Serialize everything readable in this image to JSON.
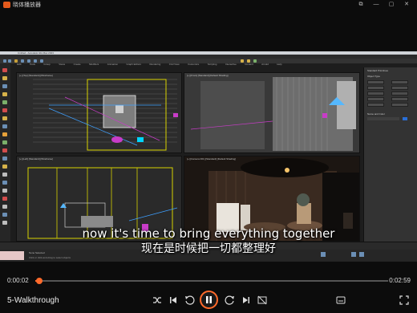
{
  "window": {
    "title": "晓体播放器",
    "controls": [
      "⧉",
      "—",
      "▢",
      "✕"
    ]
  },
  "video_frame": {
    "app_title": "Untitled - Autodesk 3ds Max 2023",
    "menu_items": [
      "File",
      "Edit",
      "Tools",
      "Group",
      "Views",
      "Create",
      "Modifiers",
      "Animation",
      "Graph Editors",
      "Rendering",
      "Civil View",
      "Customize",
      "Scripting",
      "Interactive",
      "Content",
      "Arnold",
      "Help"
    ],
    "viewports": [
      {
        "label": "[+] [Top] [Standard] [Wireframe]"
      },
      {
        "label": "[+] [Front] [Standard] [Default Shading]"
      },
      {
        "label": "[+] [Left] [Standard] [Wireframe]"
      },
      {
        "label": "[+] [Camera 001] [Standard] [Default Shading]"
      }
    ],
    "command_panel": {
      "title": "Standard Primitives",
      "section": "Object Type",
      "buttons": [
        "Box",
        "Cone",
        "Sphere",
        "GeoSphere",
        "Cylinder",
        "Tube",
        "Torus",
        "Pyramid",
        "Teapot",
        "Plane"
      ],
      "section2": "Name and Color"
    },
    "status": {
      "selection": "None Selected",
      "prompt": "Click or click-and-drag to select objects"
    }
  },
  "subtitles": {
    "english": "now it's time to bring everything together",
    "chinese": "现在是时候把一切都整理好"
  },
  "player": {
    "current_time": "0:00:02",
    "total_time": "0:02:59",
    "progress": 0.011,
    "video_name": "5-Walkthrough",
    "accent_color": "#ff6a2b"
  },
  "icons": {
    "shuffle": "shuffle-icon",
    "prev": "skip-previous-icon",
    "back": "rewind-10-icon",
    "play": "pause-icon",
    "forward": "forward-30-icon",
    "next": "skip-next-icon",
    "cast_off": "cast-off-icon",
    "subtitles": "subtitles-icon",
    "fullscreen": "fullscreen-icon"
  }
}
